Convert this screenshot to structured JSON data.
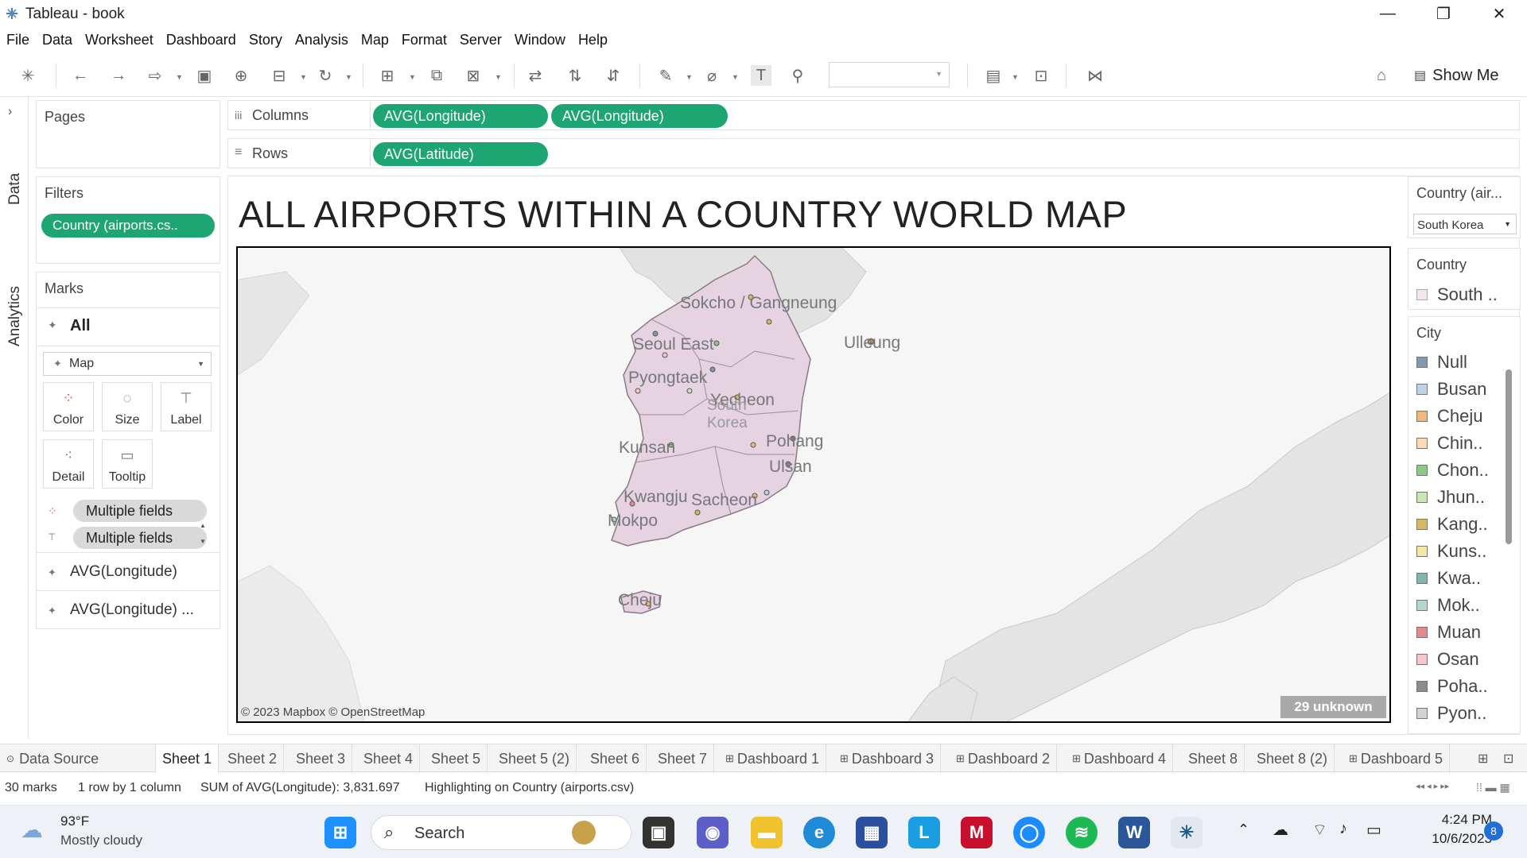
{
  "window": {
    "title": "Tableau - book",
    "minimize": "—",
    "maximize": "❐",
    "close": "✕"
  },
  "menu": [
    "File",
    "Data",
    "Worksheet",
    "Dashboard",
    "Story",
    "Analysis",
    "Map",
    "Format",
    "Server",
    "Window",
    "Help"
  ],
  "toolbar": {
    "show_me": "Show Me"
  },
  "rail": {
    "data": "Data",
    "analytics": "Analytics",
    "expand": "›"
  },
  "pages": {
    "title": "Pages"
  },
  "filters": {
    "title": "Filters",
    "pill": "Country (airports.cs.."
  },
  "marks": {
    "title": "Marks",
    "all": "All",
    "type": "Map",
    "buttons": {
      "color": "Color",
      "size": "Size",
      "label": "Label",
      "detail": "Detail",
      "tooltip": "Tooltip"
    },
    "fields": [
      "Multiple fields",
      "Multiple fields"
    ],
    "layers": [
      "AVG(Longitude)",
      "AVG(Longitude) ..."
    ]
  },
  "shelves": {
    "columns_label": "Columns",
    "columns": [
      "AVG(Longitude)",
      "AVG(Longitude)"
    ],
    "rows_label": "Rows",
    "rows": [
      "AVG(Latitude)"
    ]
  },
  "view": {
    "title": "ALL AIRPORTS WITHIN A COUNTRY WORLD MAP",
    "attribution": "© 2023 Mapbox © OpenStreetMap",
    "unknown_badge": "29 unknown",
    "map_labels": [
      "Sokcho / Gangneung",
      "Ulleung",
      "Seoul East",
      "Pyongtaek",
      "Yecheon",
      "South",
      "Korea",
      "Kunsan",
      "Pohang",
      "Ulsan",
      "Kwangju",
      "Sacheon",
      "Mokpo",
      "Cheju"
    ],
    "colors": {
      "land_highlight": "#e6d3e2",
      "land_border": "#8a7a88",
      "land_other": "#e2e2e2",
      "sea": "#f6f6f6"
    }
  },
  "legends": {
    "country_filter": {
      "title": "Country (air...",
      "value": "South Korea"
    },
    "country": {
      "title": "Country",
      "item": "South .."
    },
    "city": {
      "title": "City",
      "items": [
        {
          "name": "Null",
          "color": "#8497b0"
        },
        {
          "name": "Busan",
          "color": "#bcd3e8"
        },
        {
          "name": "Cheju",
          "color": "#f2b77a"
        },
        {
          "name": "Chin..",
          "color": "#ffd9b3"
        },
        {
          "name": "Chon..",
          "color": "#8cc88a"
        },
        {
          "name": "Jhun..",
          "color": "#c8e6b0"
        },
        {
          "name": "Kang..",
          "color": "#d8b860"
        },
        {
          "name": "Kuns..",
          "color": "#f5e7a8"
        },
        {
          "name": "Kwa..",
          "color": "#7fb5ae"
        },
        {
          "name": "Mok..",
          "color": "#b4d7d3"
        },
        {
          "name": "Muan",
          "color": "#e6898c"
        },
        {
          "name": "Osan",
          "color": "#f7c6c6"
        },
        {
          "name": "Poha..",
          "color": "#8c8c8c"
        },
        {
          "name": "Pyon..",
          "color": "#d3d3d3"
        }
      ]
    }
  },
  "tabs": [
    "Data Source",
    "Sheet 1",
    "Sheet 2",
    "Sheet 3",
    "Sheet 4",
    "Sheet 5",
    "Sheet 5 (2)",
    "Sheet 6",
    "Sheet 7",
    "Dashboard 1",
    "Dashboard 3",
    "Dashboard 2",
    "Dashboard 4",
    "Sheet 8",
    "Sheet 8 (2)",
    "Dashboard 5"
  ],
  "active_tab": "Sheet 1",
  "status": {
    "marks": "30 marks",
    "dims": "1 row by 1 column",
    "sum": "SUM of AVG(Longitude): 3,831.697",
    "highlight": "Highlighting on Country (airports.csv)"
  },
  "taskbar": {
    "temp": "93°F",
    "weather": "Mostly cloudy",
    "search": "Search",
    "time": "4:24 PM",
    "date": "10/6/2023",
    "notif": "8"
  }
}
